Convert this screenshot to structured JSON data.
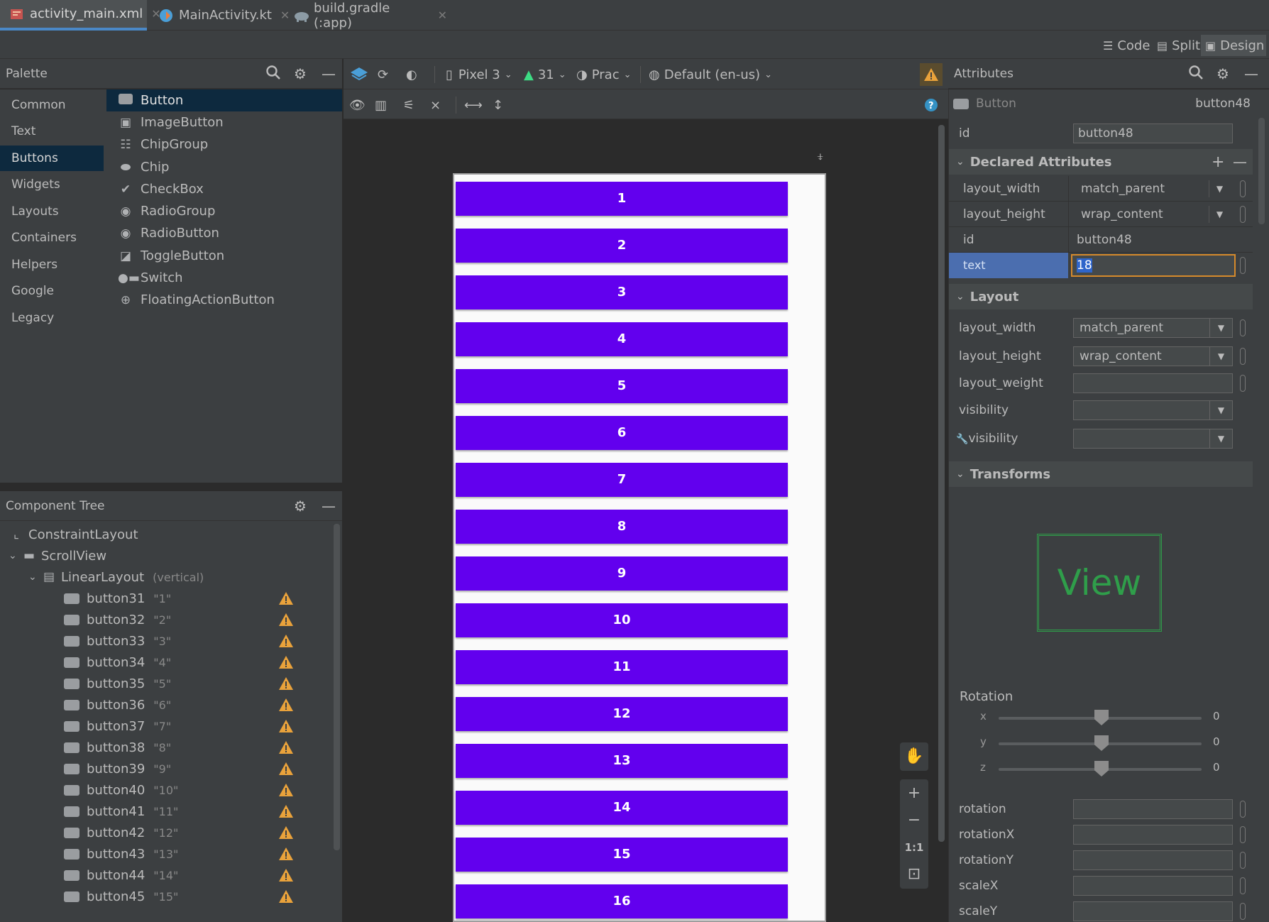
{
  "tabs": [
    {
      "label": "activity_main.xml",
      "icon": "xml-layout-icon",
      "active": true
    },
    {
      "label": "MainActivity.kt",
      "icon": "kotlin-file-icon",
      "active": false
    },
    {
      "label": "build.gradle (:app)",
      "icon": "gradle-elephant-icon",
      "active": false
    }
  ],
  "view_modes": {
    "code": "Code",
    "split": "Split",
    "design": "Design",
    "active": "Design"
  },
  "palette": {
    "title": "Palette",
    "categories": [
      "Common",
      "Text",
      "Buttons",
      "Widgets",
      "Layouts",
      "Containers",
      "Helpers",
      "Google",
      "Legacy"
    ],
    "selected_category": "Buttons",
    "items": [
      {
        "label": "Button",
        "icon": "button-icon"
      },
      {
        "label": "ImageButton",
        "icon": "image-button-icon"
      },
      {
        "label": "ChipGroup",
        "icon": "chip-group-icon"
      },
      {
        "label": "Chip",
        "icon": "chip-icon"
      },
      {
        "label": "CheckBox",
        "icon": "checkbox-icon"
      },
      {
        "label": "RadioGroup",
        "icon": "radio-group-icon"
      },
      {
        "label": "RadioButton",
        "icon": "radio-button-icon"
      },
      {
        "label": "ToggleButton",
        "icon": "toggle-button-icon"
      },
      {
        "label": "Switch",
        "icon": "switch-icon"
      },
      {
        "label": "FloatingActionButton",
        "icon": "fab-icon"
      }
    ],
    "selected_item": "Button"
  },
  "component_tree": {
    "title": "Component Tree",
    "root": "ConstraintLayout",
    "scroll": "ScrollView",
    "linear": {
      "name": "LinearLayout",
      "orientation": "(vertical)"
    },
    "buttons": [
      {
        "id": "button31",
        "text": "\"1\""
      },
      {
        "id": "button32",
        "text": "\"2\""
      },
      {
        "id": "button33",
        "text": "\"3\""
      },
      {
        "id": "button34",
        "text": "\"4\""
      },
      {
        "id": "button35",
        "text": "\"5\""
      },
      {
        "id": "button36",
        "text": "\"6\""
      },
      {
        "id": "button37",
        "text": "\"7\""
      },
      {
        "id": "button38",
        "text": "\"8\""
      },
      {
        "id": "button39",
        "text": "\"9\""
      },
      {
        "id": "button40",
        "text": "\"10\""
      },
      {
        "id": "button41",
        "text": "\"11\""
      },
      {
        "id": "button42",
        "text": "\"12\""
      },
      {
        "id": "button43",
        "text": "\"13\""
      },
      {
        "id": "button44",
        "text": "\"14\""
      },
      {
        "id": "button45",
        "text": "\"15\""
      }
    ]
  },
  "design_toolbar": {
    "device": "Pixel 3",
    "api": "31",
    "theme": "Prac",
    "locale": "Default (en-us)"
  },
  "preview_buttons": [
    "1",
    "2",
    "3",
    "4",
    "5",
    "6",
    "7",
    "8",
    "9",
    "10",
    "11",
    "12",
    "13",
    "14",
    "15",
    "16"
  ],
  "preview_colors": {
    "button": "#6200ee",
    "button_text": "#ffffff"
  },
  "zoom_controls": {
    "actual_size": "1:1"
  },
  "attributes": {
    "title": "Attributes",
    "component_type": "Button",
    "component_id": "button48",
    "id_label": "id",
    "id_value": "button48",
    "declared": {
      "title": "Declared Attributes",
      "rows": [
        {
          "name": "layout_width",
          "value": "match_parent",
          "dropdown": true
        },
        {
          "name": "layout_height",
          "value": "wrap_content",
          "dropdown": true
        },
        {
          "name": "id",
          "value": "button48",
          "dropdown": false
        },
        {
          "name": "text",
          "value": "18",
          "dropdown": false
        }
      ]
    },
    "layout": {
      "title": "Layout",
      "rows": [
        {
          "name": "layout_width",
          "value": "match_parent"
        },
        {
          "name": "layout_height",
          "value": "wrap_content"
        },
        {
          "name": "layout_weight",
          "value": ""
        },
        {
          "name": "visibility",
          "value": ""
        },
        {
          "name": "visibility",
          "value": "",
          "tools_icon": "wrench-icon"
        }
      ]
    },
    "transforms": {
      "title": "Transforms",
      "preview_label": "View",
      "rotation_label": "Rotation",
      "axes": [
        {
          "axis": "x",
          "value": "0"
        },
        {
          "axis": "y",
          "value": "0"
        },
        {
          "axis": "z",
          "value": "0"
        }
      ],
      "fields": [
        "rotation",
        "rotationX",
        "rotationY",
        "scaleX",
        "scaleY"
      ]
    }
  }
}
